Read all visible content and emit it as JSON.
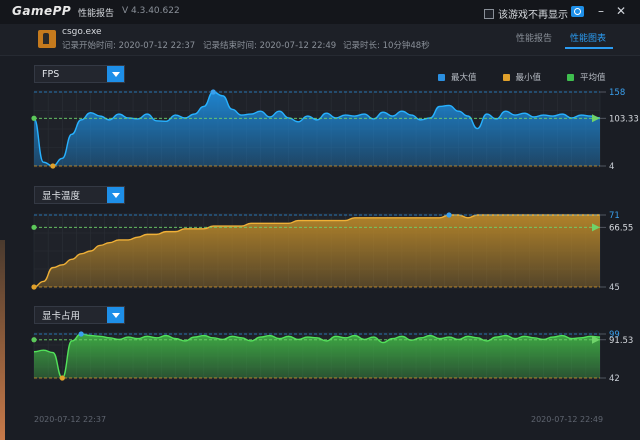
{
  "app": {
    "logo_game": "Game",
    "logo_pp": "PP",
    "report_title": "性能报告",
    "version": "V 4.3.40.622",
    "no_show_label": "该游戏不再显示",
    "icons": [
      "camera-icon",
      "minimize-icon",
      "close-icon"
    ]
  },
  "session": {
    "exe": "csgo.exe",
    "start": "记录开始时间: 2020-07-12 22:37",
    "end": "记录结束时间: 2020-07-12 22:49",
    "duration": "记录时长: 10分钟48秒"
  },
  "tabs": [
    {
      "label": "性能报告",
      "active": false
    },
    {
      "label": "性能图表",
      "active": true
    }
  ],
  "legend": [
    {
      "label": "最大值",
      "color": "#2b8fe0"
    },
    {
      "label": "最小值",
      "color": "#e0a02b"
    },
    {
      "label": "平均值",
      "color": "#3fbf4f"
    }
  ],
  "time_axis": {
    "start": "2020-07-12 22:37",
    "end": "2020-07-12 22:49"
  },
  "chart_data": [
    {
      "type": "area",
      "title": "FPS",
      "color": "#1e88d6",
      "ylim": [
        4,
        158
      ],
      "max": "158",
      "min": "4",
      "avg": "103.33",
      "avg_value": 103.33,
      "values": [
        103,
        12,
        4,
        20,
        70,
        100,
        115,
        108,
        100,
        112,
        104,
        102,
        112,
        98,
        97,
        110,
        104,
        112,
        128,
        158,
        150,
        122,
        110,
        112,
        118,
        106,
        118,
        104,
        96,
        108,
        100,
        114,
        104,
        110,
        108,
        112,
        102,
        116,
        108,
        118,
        110,
        100,
        104,
        128,
        130,
        118,
        108,
        82,
        112,
        102,
        118,
        110,
        114,
        106,
        110,
        108,
        112,
        104,
        110,
        108,
        104
      ]
    },
    {
      "type": "area",
      "title": "显卡温度",
      "color": "#b8872a",
      "ylim": [
        45,
        71
      ],
      "max": "71",
      "min": "45",
      "avg": "66.55",
      "avg_value": 66.55,
      "values": [
        45,
        47,
        52,
        53,
        55,
        57,
        58,
        60,
        61,
        62,
        62,
        63,
        64,
        64,
        65,
        65,
        66,
        66,
        66,
        67,
        67,
        67,
        67,
        68,
        68,
        68,
        68,
        68,
        69,
        69,
        69,
        69,
        69,
        69,
        70,
        70,
        70,
        70,
        70,
        70,
        70,
        70,
        70,
        70,
        71,
        71,
        70,
        71,
        71,
        71,
        71,
        71,
        71,
        71,
        71,
        71,
        71,
        71,
        71,
        71,
        71
      ]
    },
    {
      "type": "area",
      "title": "显卡占用",
      "color": "#3fae45",
      "ylim": [
        42,
        99
      ],
      "max": "99",
      "min": "42",
      "avg": "91.53",
      "avg_value": 91.53,
      "values": [
        76,
        78,
        75,
        42,
        90,
        99,
        97,
        96,
        94,
        92,
        95,
        93,
        96,
        94,
        97,
        93,
        90,
        95,
        97,
        94,
        92,
        96,
        94,
        90,
        95,
        97,
        93,
        96,
        92,
        95,
        94,
        90,
        96,
        94,
        97,
        92,
        95,
        88,
        93,
        96,
        91,
        94,
        97,
        93,
        95,
        92,
        96,
        94,
        90,
        95,
        97,
        93,
        96,
        94,
        92,
        95,
        97,
        93,
        94,
        96,
        95
      ]
    }
  ]
}
